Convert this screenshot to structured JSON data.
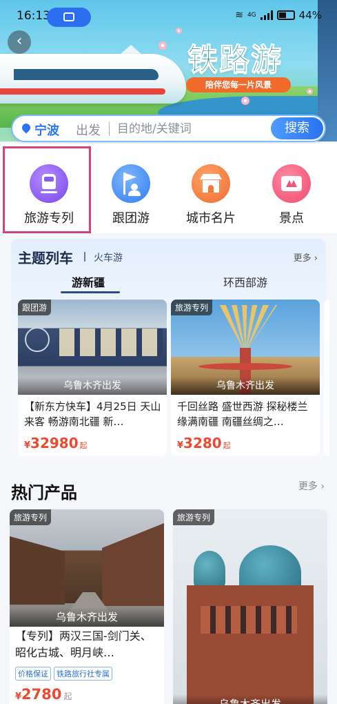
{
  "status_bar": {
    "time": "16:13",
    "network": "4G",
    "battery": "44%"
  },
  "banner": {
    "title": "铁路游",
    "subtitle": "陪伴您每一片风景"
  },
  "search": {
    "city": "宁波",
    "depart_label": "出发",
    "placeholder": "目的地/关键词",
    "button": "搜索"
  },
  "quick_nav": {
    "items": [
      {
        "label": "旅游专列",
        "icon": "train-icon",
        "color": "#8a5cf0"
      },
      {
        "label": "跟团游",
        "icon": "tour-flag-icon",
        "color": "#3f8df7"
      },
      {
        "label": "城市名片",
        "icon": "city-gate-icon",
        "color": "#f5783a"
      },
      {
        "label": "景点",
        "icon": "ticket-icon",
        "color": "#f05677"
      }
    ]
  },
  "theme_trains": {
    "title": "主题列车",
    "subtitle": "火车游",
    "more": "更多",
    "tabs": [
      "游新疆",
      "环西部游"
    ],
    "active_tab": "游新疆",
    "cards": [
      {
        "tag": "跟团游",
        "origin": "乌鲁木齐出发",
        "name": "【新东方快车】4月25日 天山来客 畅游南北疆 新…",
        "currency": "¥",
        "price": "32980",
        "suffix": "起"
      },
      {
        "tag": "旅游专列",
        "origin": "乌鲁木齐出发",
        "name": "千回丝路 盛世西游 探秘楼兰 缘满南疆 南疆丝绸之…",
        "currency": "¥",
        "price": "3280",
        "suffix": "起"
      }
    ]
  },
  "hot_products": {
    "title": "热门产品",
    "more": "更多",
    "items": [
      {
        "tag": "旅游专列",
        "origin": "乌鲁木齐出发",
        "name": "【专列】两汉三国-剑门关、昭化古城、明月峡…",
        "badges": [
          "价格保证",
          "铁路旅行社专属"
        ],
        "currency": "¥",
        "price": "2780",
        "suffix": "起"
      },
      {
        "tag": "旅游专列",
        "origin": "乌鲁木齐出发"
      }
    ]
  },
  "colors": {
    "accent": "#2b74f4",
    "price": "#ea4a2f",
    "highlight": "#d6417c"
  }
}
